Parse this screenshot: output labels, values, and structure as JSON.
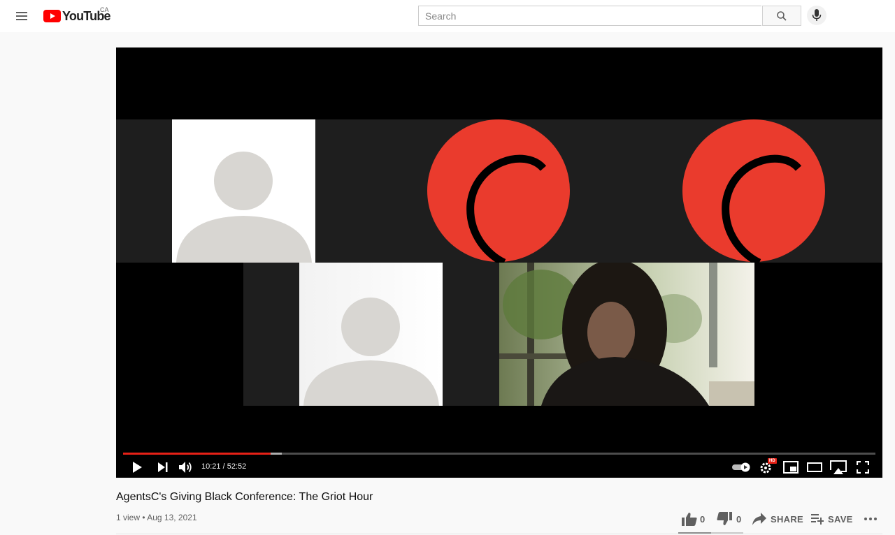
{
  "header": {
    "logo_text": "YouTube",
    "country_code": "CA",
    "search_placeholder": "Search",
    "icons": [
      "menu-icon",
      "search-icon",
      "mic-icon"
    ]
  },
  "player": {
    "current_time": "10:21",
    "duration": "52:52",
    "time_display": "10:21 / 52:52",
    "played_fraction": 0.196,
    "buffered_fraction": 0.211,
    "settings_badge": "HD",
    "controls": [
      "play-icon",
      "next-icon",
      "volume-icon",
      "autoplay-toggle",
      "settings-icon",
      "miniplayer-icon",
      "theater-icon",
      "cast-icon",
      "fullscreen-icon"
    ],
    "colors": {
      "progress": "#e62117",
      "logo_red": "#ea3b2d"
    }
  },
  "video": {
    "title": "AgentsC's Giving Black Conference: The Griot Hour",
    "meta": "1 view • Aug 13, 2021",
    "likes": "0",
    "dislikes": "0",
    "like_fraction": 0.5,
    "share_label": "SHARE",
    "save_label": "SAVE"
  }
}
